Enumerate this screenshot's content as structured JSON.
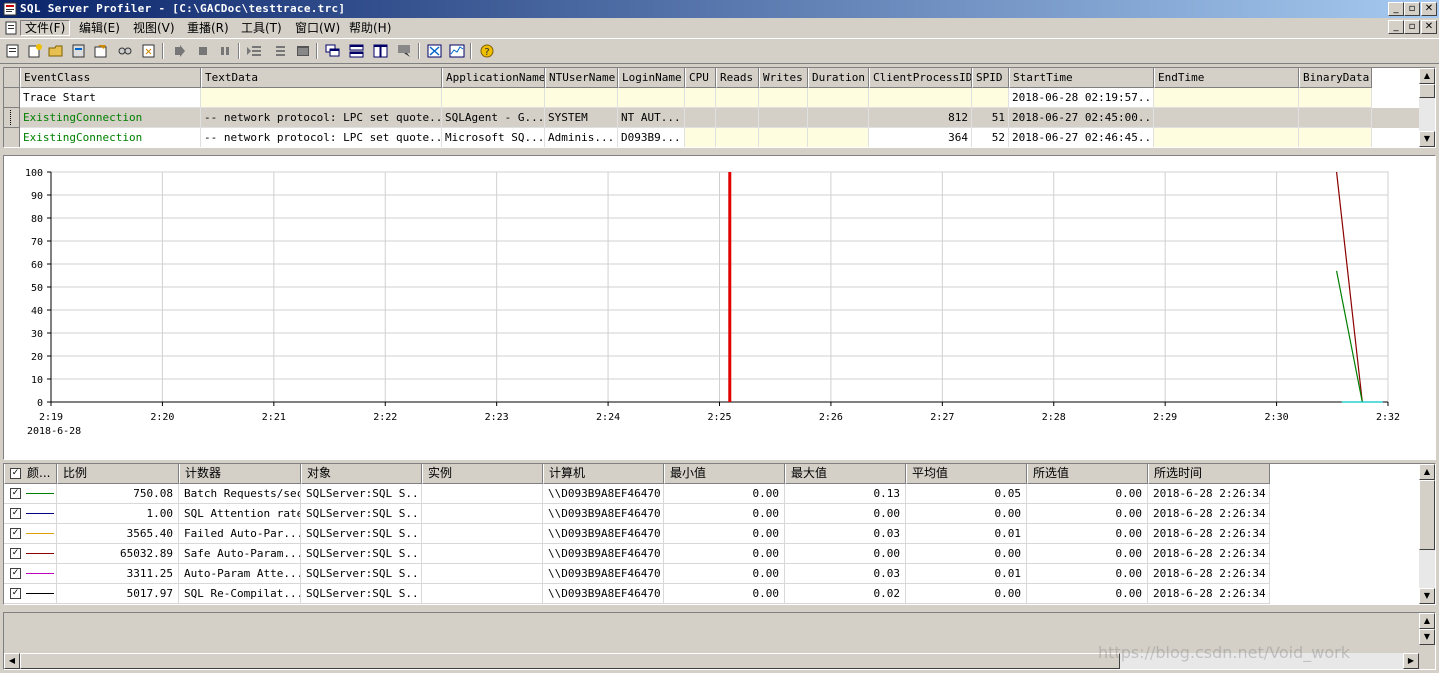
{
  "window": {
    "title": "SQL Server Profiler - [C:\\GACDoc\\testtrace.trc]",
    "min": "_",
    "restore": "▫",
    "close": "✕"
  },
  "menu": [
    "文件(F)",
    "编辑(E)",
    "视图(V)",
    "重播(R)",
    "工具(T)",
    "窗口(W)",
    "帮助(H)"
  ],
  "events": {
    "columns": [
      "EventClass",
      "TextData",
      "ApplicationName",
      "NTUserName",
      "LoginName",
      "CPU",
      "Reads",
      "Writes",
      "Duration",
      "ClientProcessID",
      "SPID",
      "StartTime",
      "EndTime",
      "BinaryData"
    ],
    "rows": [
      [
        "Trace Start",
        "",
        "",
        "",
        "",
        "",
        "",
        "",
        "",
        "",
        "",
        "2018-06-28 02:19:57...",
        "",
        ""
      ],
      [
        "ExistingConnection",
        "-- network protocol: LPC  set quote...",
        "SQLAgent - G...",
        "SYSTEM",
        "NT AUT...",
        "",
        "",
        "",
        "",
        "812",
        "51",
        "2018-06-27 02:45:00...",
        "",
        ""
      ],
      [
        "ExistingConnection",
        "-- network protocol: LPC  set quote...",
        "Microsoft SQ...",
        "Adminis...",
        "D093B9...",
        "",
        "",
        "",
        "",
        "364",
        "52",
        "2018-06-27 02:46:45...",
        "",
        ""
      ]
    ]
  },
  "chart_data": {
    "type": "line",
    "x": [
      "2:19",
      "2:20",
      "2:21",
      "2:22",
      "2:23",
      "2:24",
      "2:25",
      "2:26",
      "2:27",
      "2:28",
      "2:29",
      "2:30",
      "2:32"
    ],
    "x_date": "2018-6-28",
    "y_ticks": [
      100,
      90,
      80,
      70,
      60,
      50,
      40,
      30,
      20,
      10,
      0
    ],
    "ylim": [
      0,
      100
    ],
    "marker_time": "2:25.6",
    "series": [
      {
        "color": "#8b0000",
        "points": [
          [
            31.5,
            100
          ],
          [
            31.75,
            0
          ]
        ]
      },
      {
        "color": "#008000",
        "points": [
          [
            31.5,
            57
          ],
          [
            31.75,
            0
          ]
        ]
      },
      {
        "color": "#00c8c8",
        "points": [
          [
            31.55,
            0
          ],
          [
            31.95,
            0
          ]
        ]
      }
    ],
    "marker_color": "#e00000"
  },
  "counters": {
    "columns": [
      "颜...",
      "比例",
      "计数器",
      "对象",
      "实例",
      "计算机",
      "最小值",
      "最大值",
      "平均值",
      "所选值",
      "所选时间"
    ],
    "rows": [
      {
        "color": "#008000",
        "scale": "750.08",
        "counter": "Batch Requests/sec",
        "object": "SQLServer:SQL S...",
        "instance": "",
        "computer": "\\\\D093B9A8EF46470",
        "min": "0.00",
        "max": "0.13",
        "avg": "0.05",
        "sel": "0.00",
        "time": "2018-6-28 2:26:34"
      },
      {
        "color": "#000080",
        "scale": "1.00",
        "counter": "SQL Attention rate",
        "object": "SQLServer:SQL S...",
        "instance": "",
        "computer": "\\\\D093B9A8EF46470",
        "min": "0.00",
        "max": "0.00",
        "avg": "0.00",
        "sel": "0.00",
        "time": "2018-6-28 2:26:34"
      },
      {
        "color": "#e0a000",
        "scale": "3565.40",
        "counter": "Failed Auto-Par...",
        "object": "SQLServer:SQL S...",
        "instance": "",
        "computer": "\\\\D093B9A8EF46470",
        "min": "0.00",
        "max": "0.03",
        "avg": "0.01",
        "sel": "0.00",
        "time": "2018-6-28 2:26:34"
      },
      {
        "color": "#8b0000",
        "scale": "65032.89",
        "counter": "Safe Auto-Param...",
        "object": "SQLServer:SQL S...",
        "instance": "",
        "computer": "\\\\D093B9A8EF46470",
        "min": "0.00",
        "max": "0.00",
        "avg": "0.00",
        "sel": "0.00",
        "time": "2018-6-28 2:26:34"
      },
      {
        "color": "#c000c0",
        "scale": "3311.25",
        "counter": "Auto-Param Atte...",
        "object": "SQLServer:SQL S...",
        "instance": "",
        "computer": "\\\\D093B9A8EF46470",
        "min": "0.00",
        "max": "0.03",
        "avg": "0.01",
        "sel": "0.00",
        "time": "2018-6-28 2:26:34"
      },
      {
        "color": "#000000",
        "scale": "5017.97",
        "counter": "SQL Re-Compilat...",
        "object": "SQLServer:SQL S...",
        "instance": "",
        "computer": "\\\\D093B9A8EF46470",
        "min": "0.00",
        "max": "0.02",
        "avg": "0.00",
        "sel": "0.00",
        "time": "2018-6-28 2:26:34"
      }
    ]
  },
  "watermark": "https://blog.csdn.net/Void_work"
}
